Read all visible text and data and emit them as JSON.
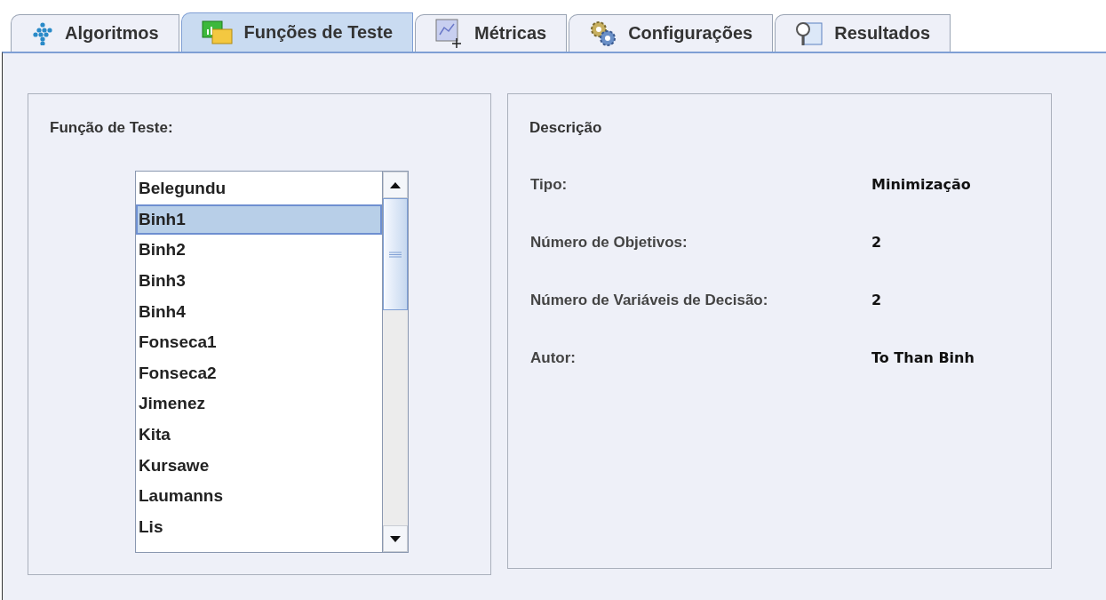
{
  "tabs": [
    {
      "label": "Algoritmos",
      "kind": "dots",
      "selected": false
    },
    {
      "label": "Funções de Teste",
      "kind": "folder",
      "selected": true
    },
    {
      "label": "Métricas",
      "kind": "chart",
      "selected": false
    },
    {
      "label": "Configurações",
      "kind": "gears",
      "selected": false
    },
    {
      "label": "Resultados",
      "kind": "magnifier",
      "selected": false
    }
  ],
  "test_function": {
    "title": "Função de Teste:",
    "items": [
      {
        "label": "Belegundu",
        "selected": false
      },
      {
        "label": "Binh1",
        "selected": true
      },
      {
        "label": "Binh2",
        "selected": false
      },
      {
        "label": "Binh3",
        "selected": false
      },
      {
        "label": "Binh4",
        "selected": false
      },
      {
        "label": "Fonseca1",
        "selected": false
      },
      {
        "label": "Fonseca2",
        "selected": false
      },
      {
        "label": "Jimenez",
        "selected": false
      },
      {
        "label": "Kita",
        "selected": false
      },
      {
        "label": "Kursawe",
        "selected": false
      },
      {
        "label": "Laumanns",
        "selected": false
      },
      {
        "label": "Lis",
        "selected": false
      }
    ]
  },
  "description": {
    "title": "Descrição",
    "rows": [
      {
        "label": "Tipo:",
        "value": "Minimização"
      },
      {
        "label": "Número de Objetivos:",
        "value": "2"
      },
      {
        "label": "Número de Variáveis de Decisão:",
        "value": "2"
      },
      {
        "label": "Autor:",
        "value": "To Than Binh"
      }
    ]
  }
}
